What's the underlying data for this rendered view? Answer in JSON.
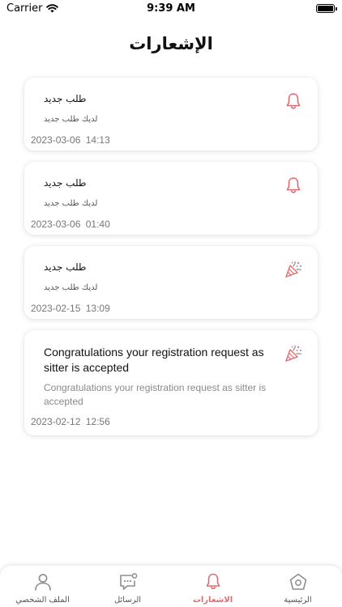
{
  "status": {
    "carrier": "Carrier",
    "time": "9:39 AM"
  },
  "page_title": "الإشعارات",
  "colors": {
    "accent": "#e26a6f",
    "icon_gray": "#8d8d8d",
    "card_bg": "#ffffff"
  },
  "notifications": [
    {
      "icon": "bell-icon",
      "title": "طلب جديد",
      "body": "لديك طلب جديد",
      "date": "2023-03-06",
      "time": "14:13"
    },
    {
      "icon": "bell-icon",
      "title": "طلب جديد",
      "body": "لديك طلب جديد",
      "date": "2023-03-06",
      "time": "01:40"
    },
    {
      "icon": "party-popper-icon",
      "title": "طلب جديد",
      "body": "لديك طلب جديد",
      "date": "2023-02-15",
      "time": "13:09"
    },
    {
      "icon": "party-popper-icon",
      "title": "Congratulations your registration request as sitter is accepted",
      "body": "Congratulations your registration request as sitter is accepted",
      "date": "2023-02-12",
      "time": "12:56"
    }
  ],
  "tabs": [
    {
      "label": "الملف الشخصي",
      "icon": "user-icon",
      "active": false
    },
    {
      "label": "الرسائل",
      "icon": "chat-icon",
      "active": false
    },
    {
      "label": "الاشعارات",
      "icon": "bell-icon",
      "active": true
    },
    {
      "label": "الرئيسية",
      "icon": "home-icon",
      "active": false
    }
  ]
}
